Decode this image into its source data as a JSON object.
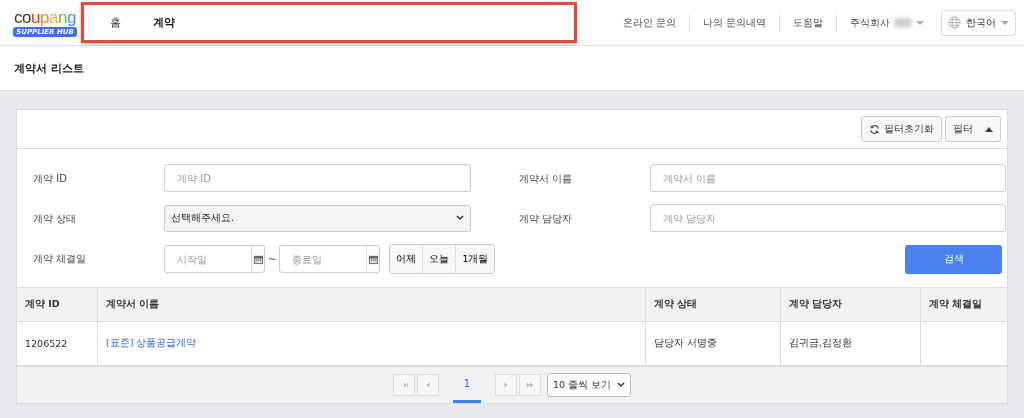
{
  "header": {
    "logo": {
      "wordmark": "coupang",
      "badge": "SUPPLIER HUB"
    },
    "nav": [
      {
        "label": "홈",
        "selected": false
      },
      {
        "label": "계약",
        "selected": true
      }
    ],
    "links": [
      "온라인 문의",
      "나의 문의내역",
      "도움말"
    ],
    "account": "주식회사",
    "language": "한국어"
  },
  "page_title": "계약서 리스트",
  "filter": {
    "reset_button": "필터초기화",
    "toggle": {
      "label": "필터",
      "expanded": true
    },
    "fields": [
      {
        "kind": "text",
        "label": "계약 ID",
        "placeholder": "계약 ID"
      },
      {
        "kind": "text",
        "label": "계약서 이름",
        "placeholder": "계약서 이름"
      },
      {
        "kind": "select",
        "label": "계약 상태",
        "value": "선택해주세요."
      },
      {
        "kind": "text",
        "label": "계약 담당자",
        "placeholder": "계약 담당자"
      },
      {
        "kind": "daterange",
        "label": "계약 체결일",
        "start_placeholder": "시작일",
        "separator": "~",
        "end_placeholder": "종료일",
        "quick": [
          "어제",
          "오늘",
          "1개월"
        ]
      }
    ],
    "search_button": "검색"
  },
  "table": {
    "columns": [
      "계약 ID",
      "계약서 이름",
      "계약 상태",
      "계약 담당자",
      "계약 체결일"
    ],
    "rows": [
      [
        "1206522",
        "[표준] 상품공급계약",
        "담당자 서명중",
        "김귀금,김정환",
        ""
      ]
    ]
  },
  "pagination": {
    "pages": [
      {
        "label": "1",
        "selected": true
      }
    ],
    "page_size": "10 줄씩 보기"
  }
}
